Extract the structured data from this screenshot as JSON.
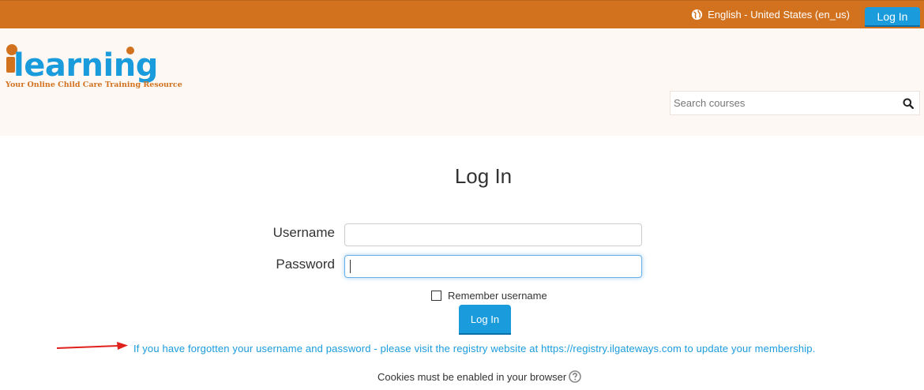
{
  "topbar": {
    "language": "English - United States (en_us)",
    "login_button": "Log In",
    "globe_icon": "globe-icon",
    "background_color": "#d2721f"
  },
  "header": {
    "logo": {
      "text": "learning",
      "prefix": "i",
      "tagline": "Your Online Child Care Training Resource"
    },
    "search": {
      "placeholder": "Search courses",
      "icon": "search-icon"
    }
  },
  "main": {
    "title": "Log In",
    "username_label": "Username",
    "username_value": "",
    "password_label": "Password",
    "password_value": "",
    "remember_label": "Remember username",
    "remember_checked": false,
    "login_button": "Log In",
    "forgot_text": "If you have forgotten your username and password - please visit the registry website at https://registry.ilgateways.com to update your membership.",
    "cookies_text": "Cookies must be enabled in your browser",
    "help_icon": "question-circle-icon"
  },
  "colors": {
    "accent": "#1a9bdc",
    "brand_orange": "#d2721f",
    "arrow_red": "#e0201c"
  }
}
